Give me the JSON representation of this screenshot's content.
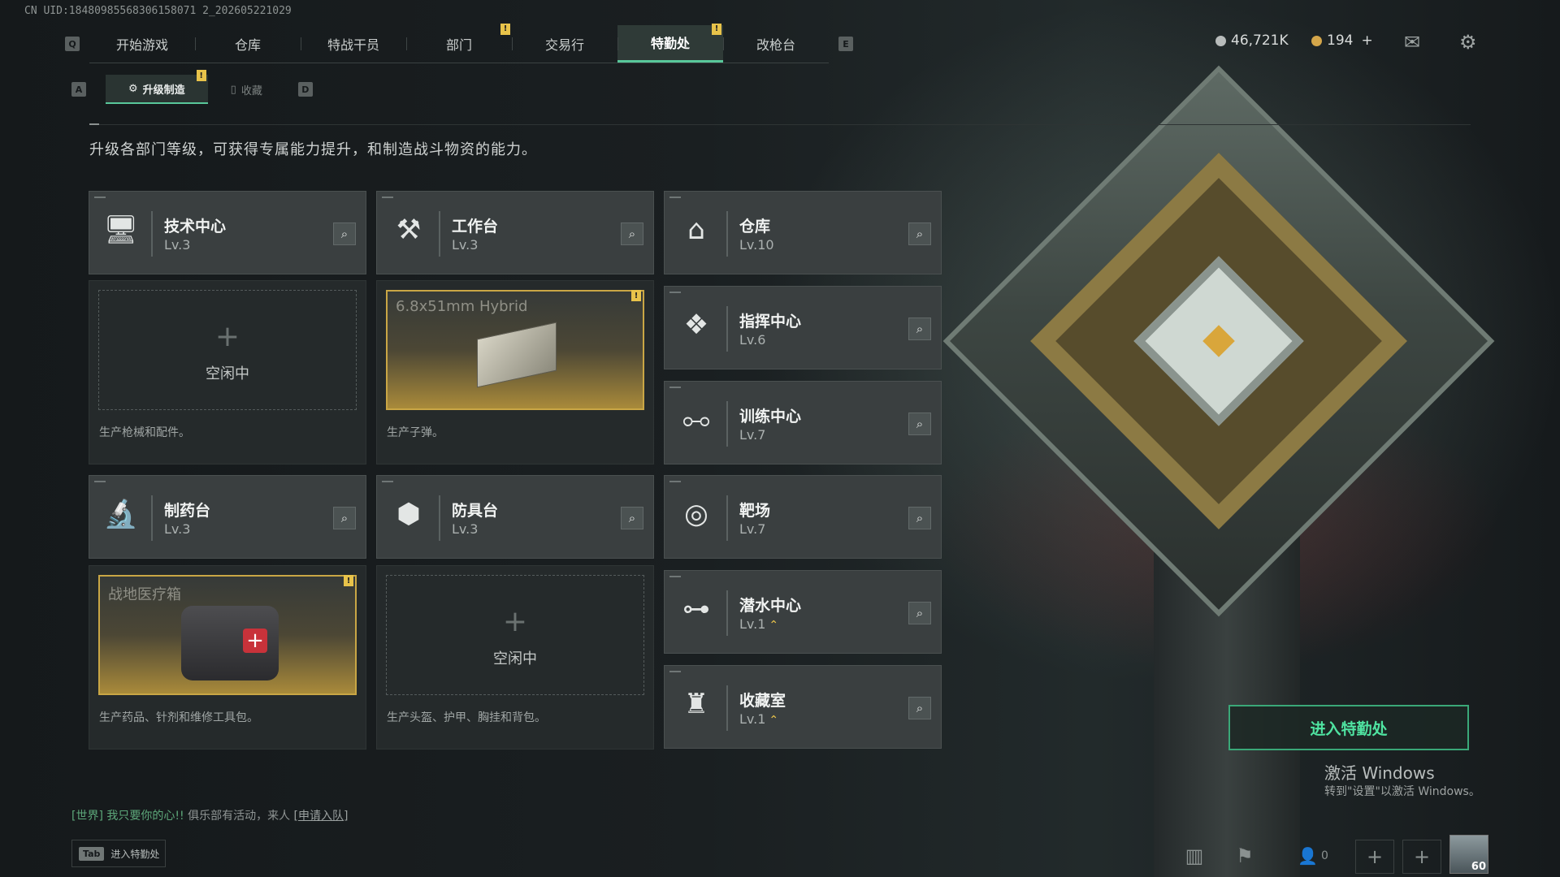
{
  "uid": "CN UID:18480985568306158071 2_202605221029",
  "nav": {
    "left_key": "Q",
    "right_key": "E",
    "tabs": [
      {
        "label": "开始游戏"
      },
      {
        "label": "仓库"
      },
      {
        "label": "特战干员"
      },
      {
        "label": "部门",
        "badge": "!"
      },
      {
        "label": "交易行"
      },
      {
        "label": "特勤处",
        "badge": "!",
        "active": true
      },
      {
        "label": "改枪台"
      }
    ]
  },
  "currency": {
    "coins": "46,721K",
    "premium": "194",
    "premium_add": "+",
    "coin_color": "#b8bcbb",
    "premium_color": "#d4a64a"
  },
  "header_icons": {
    "mail": "mail-icon",
    "settings": "gear-icon"
  },
  "subnav": {
    "left_key": "A",
    "right_key": "D",
    "tabs": [
      {
        "label": "升级制造",
        "badge": "!",
        "active": true
      },
      {
        "label": "收藏"
      }
    ]
  },
  "description": "升级各部门等级，可获得专属能力提升，和制造战斗物资的能力。",
  "departments": {
    "tech_center": {
      "name": "技术中心",
      "level": "Lv.3",
      "icon": "monitor-icon"
    },
    "workbench": {
      "name": "工作台",
      "level": "Lv.3",
      "icon": "wrench-hammer-icon"
    },
    "pharmacy": {
      "name": "制药台",
      "level": "Lv.3",
      "icon": "microscope-icon"
    },
    "armor_bench": {
      "name": "防具台",
      "level": "Lv.3",
      "icon": "cubes-icon"
    },
    "warehouse": {
      "name": "仓库",
      "level": "Lv.10",
      "icon": "warehouse-icon"
    },
    "command_center": {
      "name": "指挥中心",
      "level": "Lv.6",
      "icon": "command-icon"
    },
    "training_center": {
      "name": "训练中心",
      "level": "Lv.7",
      "icon": "dumbbell-icon"
    },
    "shooting_range": {
      "name": "靶场",
      "level": "Lv.7",
      "icon": "target-icon"
    },
    "diving_center": {
      "name": "潜水中心",
      "level": "Lv.1",
      "icon": "diving-mask-icon",
      "upgrade": "⌃"
    },
    "collection_room": {
      "name": "收藏室",
      "level": "Lv.1",
      "icon": "trophy-case-icon",
      "upgrade": "⌃"
    }
  },
  "slots": {
    "tech_center": {
      "state": "idle",
      "plus": "+",
      "idle_label": "空闲中",
      "caption": "生产枪械和配件。"
    },
    "workbench": {
      "state": "producing",
      "product": "6.8x51mm Hybrid",
      "badge": "!",
      "caption": "生产子弹。"
    },
    "pharmacy": {
      "state": "producing",
      "product": "战地医疗箱",
      "badge": "!",
      "caption": "生产药品、针剂和维修工具包。"
    },
    "armor_bench": {
      "state": "idle",
      "plus": "+",
      "idle_label": "空闲中",
      "caption": "生产头盔、护甲、胸挂和背包。"
    }
  },
  "enter_button": "进入特勤处",
  "windows_notice": {
    "title": "激活 Windows",
    "subtitle": "转到\"设置\"以激活 Windows。"
  },
  "chat": {
    "channel": "[世界]",
    "user": "我只要你的心!!",
    "message": "俱乐部有活动，来人",
    "link": "[申请入队]"
  },
  "tab_hint": {
    "key": "Tab",
    "label": "进入特勤处"
  },
  "dock": {
    "friends_count": "0",
    "level": "60"
  }
}
